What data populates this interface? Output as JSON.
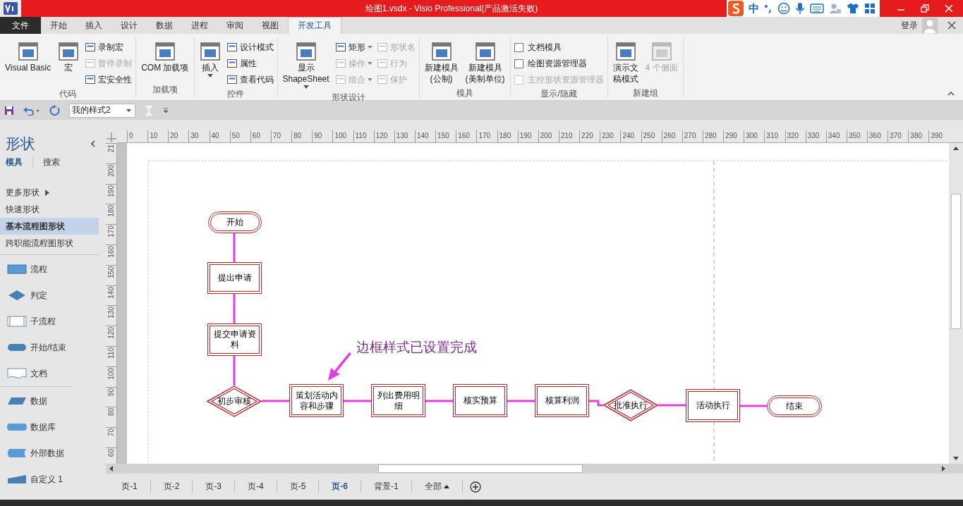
{
  "window": {
    "title": "绘图1.vsdx - Visio Professional(产品激活失败)"
  },
  "ime_toolbar": {
    "mode": "中"
  },
  "menu_tabs": [
    {
      "label": "文件",
      "kind": "file",
      "selected": false
    },
    {
      "label": "开始",
      "kind": "tab",
      "selected": false
    },
    {
      "label": "插入",
      "kind": "tab",
      "selected": false
    },
    {
      "label": "设计",
      "kind": "tab",
      "selected": false
    },
    {
      "label": "数据",
      "kind": "tab",
      "selected": false
    },
    {
      "label": "进程",
      "kind": "tab",
      "selected": false
    },
    {
      "label": "审阅",
      "kind": "tab",
      "selected": false
    },
    {
      "label": "视图",
      "kind": "tab",
      "selected": false
    },
    {
      "label": "开发工具",
      "kind": "tab",
      "selected": true
    }
  ],
  "account": {
    "label": "登录"
  },
  "ribbon_groups": [
    {
      "name": "代码",
      "items": [
        {
          "kind": "large",
          "lines": [
            "Visual Basic"
          ],
          "dropdown": false,
          "disabled": false
        },
        {
          "kind": "large",
          "lines": [
            "宏"
          ],
          "dropdown": false,
          "disabled": false
        },
        {
          "kind": "stack",
          "items": [
            {
              "label": "录制宏",
              "dropdown": false,
              "disabled": false
            },
            {
              "label": "暂停录制",
              "dropdown": false,
              "disabled": true
            },
            {
              "label": "宏安全性",
              "dropdown": false,
              "disabled": false
            }
          ]
        }
      ]
    },
    {
      "name": "加载项",
      "items": [
        {
          "kind": "large",
          "lines": [
            "COM 加载项"
          ],
          "dropdown": false,
          "disabled": false
        }
      ]
    },
    {
      "name": "控件",
      "items": [
        {
          "kind": "large",
          "lines": [
            "插入"
          ],
          "dropdown": true,
          "disabled": false
        },
        {
          "kind": "stack",
          "items": [
            {
              "label": "设计模式",
              "dropdown": false,
              "disabled": false
            },
            {
              "label": "属性",
              "dropdown": false,
              "disabled": false
            },
            {
              "label": "查看代码",
              "dropdown": false,
              "disabled": false
            }
          ]
        }
      ]
    },
    {
      "name": "形状设计",
      "items": [
        {
          "kind": "large",
          "lines": [
            "显示",
            "ShapeSheet"
          ],
          "dropdown": true,
          "disabled": false
        },
        {
          "kind": "stack",
          "items": [
            {
              "label": "矩形",
              "dropdown": true,
              "disabled": false
            },
            {
              "label": "操作",
              "dropdown": true,
              "disabled": true
            },
            {
              "label": "组合",
              "dropdown": true,
              "disabled": true
            }
          ]
        },
        {
          "kind": "stack",
          "items": [
            {
              "label": "形状名",
              "dropdown": false,
              "disabled": true
            },
            {
              "label": "行为",
              "dropdown": false,
              "disabled": true
            },
            {
              "label": "保护",
              "dropdown": false,
              "disabled": true
            }
          ]
        }
      ]
    },
    {
      "name": "模具",
      "items": [
        {
          "kind": "large",
          "lines": [
            "新建模具",
            "(公制)"
          ],
          "dropdown": false,
          "disabled": false
        },
        {
          "kind": "large",
          "lines": [
            "新建模具",
            "(美制单位)"
          ],
          "dropdown": false,
          "disabled": false
        }
      ]
    },
    {
      "name": "显示/隐藏",
      "items": [
        {
          "kind": "checks",
          "items": [
            {
              "label": "文档模具",
              "checked": false,
              "disabled": false
            },
            {
              "label": "绘图资源管理器",
              "checked": false,
              "disabled": false
            },
            {
              "label": "主控形状资源管理器",
              "checked": false,
              "disabled": true
            }
          ]
        }
      ]
    },
    {
      "name": "新建组",
      "items": [
        {
          "kind": "large",
          "lines": [
            "演示文",
            "稿模式"
          ],
          "dropdown": false,
          "disabled": false
        },
        {
          "kind": "large",
          "lines": [
            "4 个侧面"
          ],
          "dropdown": false,
          "disabled": true
        }
      ]
    }
  ],
  "quick_access": {
    "style_value": "我的样式2"
  },
  "shapes_panel": {
    "title": "形状",
    "tabs": [
      {
        "label": "模具",
        "selected": true
      },
      {
        "label": "搜索",
        "selected": false
      }
    ],
    "nav": [
      {
        "label": "更多形状",
        "selected": false,
        "submenu": true
      },
      {
        "label": "快速形状",
        "selected": false,
        "submenu": false
      },
      {
        "label": "基本流程图形状",
        "selected": true,
        "submenu": false
      },
      {
        "label": "跨职能流程图形状",
        "selected": false,
        "submenu": false
      }
    ],
    "shape_groups": [
      {
        "shapes": [
          {
            "kind": "process",
            "label": "流程"
          },
          {
            "kind": "decision",
            "label": "判定"
          },
          {
            "kind": "subprocess",
            "label": "子流程"
          },
          {
            "kind": "terminator",
            "label": "开始/结束"
          },
          {
            "kind": "document",
            "label": "文档"
          }
        ]
      },
      {
        "shapes": [
          {
            "kind": "data",
            "label": "数据"
          },
          {
            "kind": "database",
            "label": "数据库"
          },
          {
            "kind": "external",
            "label": "外部数据"
          },
          {
            "kind": "manual",
            "label": "自定义 1"
          }
        ]
      }
    ]
  },
  "horizontal_ruler": [
    "0",
    "10",
    "20",
    "30",
    "40",
    "50",
    "60",
    "70",
    "80",
    "90",
    "100",
    "110",
    "120",
    "130",
    "140",
    "150",
    "160",
    "170",
    "180",
    "190",
    "200",
    "210",
    "220",
    "230",
    "240",
    "250",
    "260",
    "270",
    "280",
    "290",
    "300",
    "310",
    "320",
    "330",
    "340",
    "350",
    "360",
    "370",
    "380",
    "390"
  ],
  "vertical_ruler": [
    "21",
    "200",
    "190",
    "180",
    "170",
    "160",
    "150",
    "140",
    "130",
    "120",
    "110",
    "100",
    "90",
    "80",
    "70",
    "60"
  ],
  "flowchart": {
    "nodes": [
      {
        "kind": "terminator",
        "label": "开始"
      },
      {
        "kind": "process",
        "label": "提出申请"
      },
      {
        "kind": "process",
        "label": "提交申请资料"
      },
      {
        "kind": "decision",
        "label": "初步审核"
      },
      {
        "kind": "process",
        "label": "策划活动内容和步骤"
      },
      {
        "kind": "process",
        "label": "列出费用明细"
      },
      {
        "kind": "process",
        "label": "核实预算"
      },
      {
        "kind": "process",
        "label": "核算利润"
      },
      {
        "kind": "decision",
        "label": "批准执行"
      },
      {
        "kind": "process",
        "label": "活动执行"
      },
      {
        "kind": "terminator",
        "label": "结束"
      }
    ],
    "annotation": "边框样式已设置完成"
  },
  "page_tabs": [
    {
      "label": "页-1",
      "kind": "page",
      "selected": false
    },
    {
      "label": "页-2",
      "kind": "page",
      "selected": false
    },
    {
      "label": "页-3",
      "kind": "page",
      "selected": false
    },
    {
      "label": "页-4",
      "kind": "page",
      "selected": false
    },
    {
      "label": "页-5",
      "kind": "page",
      "selected": false
    },
    {
      "label": "页-6",
      "kind": "page",
      "selected": true
    },
    {
      "label": "背景-1",
      "kind": "page",
      "selected": false
    },
    {
      "label": "全部",
      "kind": "menu",
      "selected": false
    }
  ]
}
